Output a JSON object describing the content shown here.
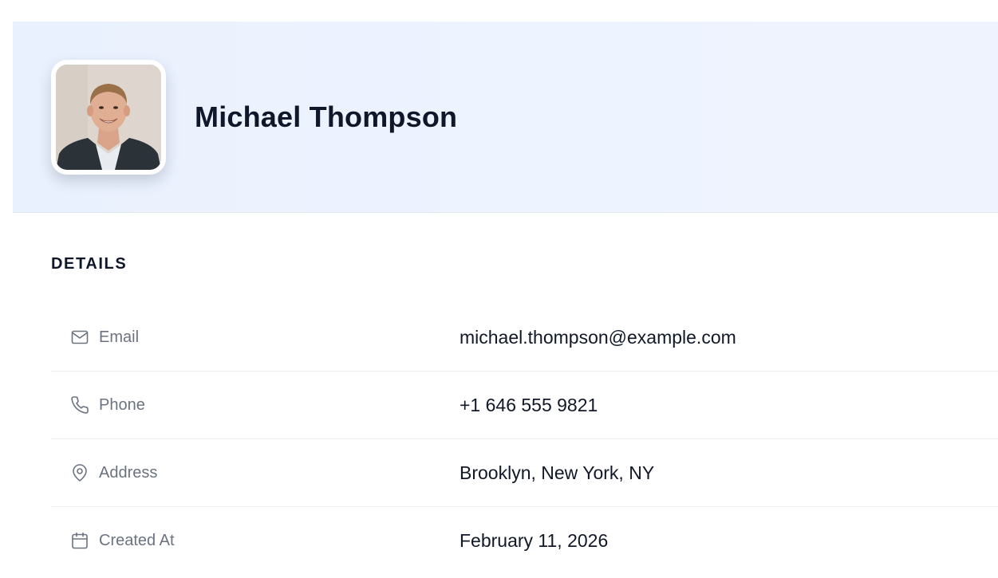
{
  "profile": {
    "name": "Michael Thompson",
    "avatar_alt": "Michael Thompson"
  },
  "details": {
    "title": "DETAILS",
    "rows": [
      {
        "icon": "mail-icon",
        "label": "Email",
        "value": "michael.thompson@example.com"
      },
      {
        "icon": "phone-icon",
        "label": "Phone",
        "value": "+1 646 555 9821"
      },
      {
        "icon": "map-pin-icon",
        "label": "Address",
        "value": "Brooklyn, New York, NY"
      },
      {
        "icon": "calendar-icon",
        "label": "Created At",
        "value": "February 11, 2026"
      }
    ]
  },
  "colors": {
    "header_bg": "#edf3ff",
    "name_text": "#0f172a",
    "label_text": "#6b7280",
    "value_text": "#111827",
    "divider": "#eef0f3"
  }
}
